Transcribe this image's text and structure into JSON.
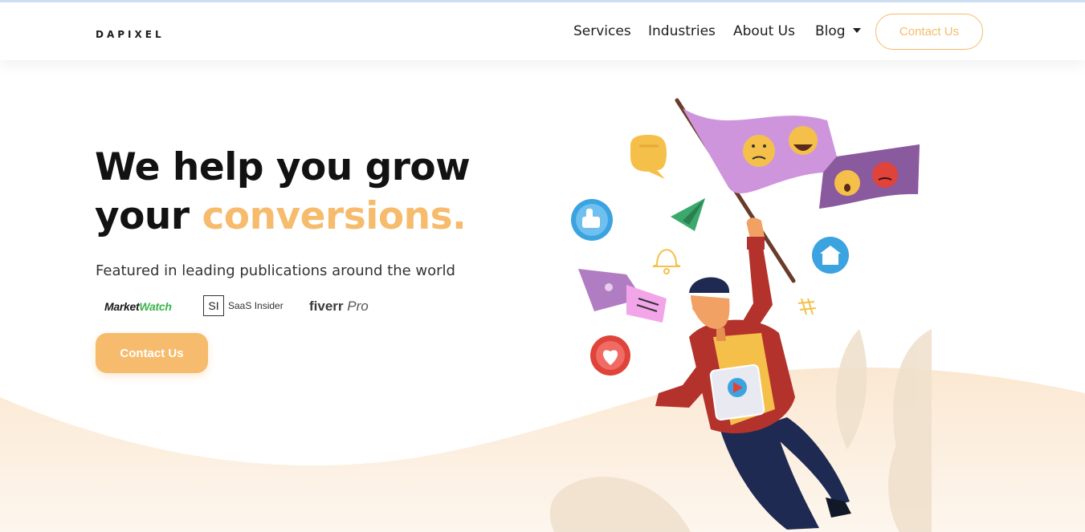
{
  "brand": {
    "logo_text": "DAPIXEL"
  },
  "nav": {
    "items": [
      {
        "label": "Services"
      },
      {
        "label": "Industries"
      },
      {
        "label": "About Us"
      },
      {
        "label": "Blog"
      }
    ],
    "contact_label": "Contact Us"
  },
  "hero": {
    "title_line1": "We help you grow",
    "title_line2_prefix": "your ",
    "title_line2_accent": "conversions.",
    "featured_text": "Featured in leading publications around the world",
    "publications": {
      "marketwatch_a": "Market",
      "marketwatch_b": "Watch",
      "saas_mark": "SI",
      "saas_name": "SaaS Insider",
      "fiverr_a": "fiverr",
      "fiverr_b": "Pro"
    },
    "cta_label": "Contact Us"
  },
  "icons": [
    "caret-down-icon",
    "chat-bubble-icon",
    "paper-plane-icon",
    "bell-icon",
    "thumbs-up-icon",
    "house-icon",
    "heart-icon",
    "hashtag-icon",
    "image-card-icon",
    "play-icon"
  ],
  "colors": {
    "accent": "#f6bb6c",
    "text": "#121212",
    "wave": "#fdf0e0",
    "flag": "#cf95dc"
  }
}
